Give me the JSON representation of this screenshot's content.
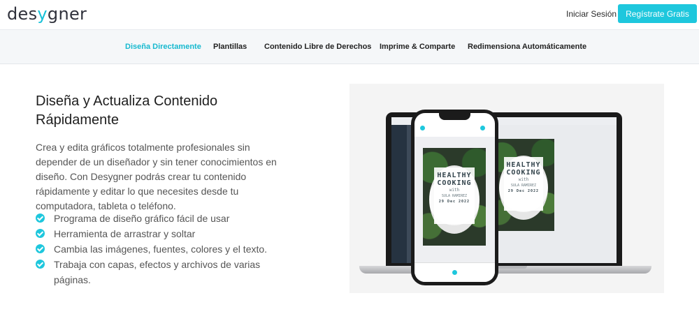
{
  "header": {
    "logo": {
      "part1": "des",
      "part2": "y",
      "part3": "gner"
    },
    "login_label": "Iniciar Sesión",
    "register_label": "Regístrate Gratis"
  },
  "nav": {
    "items": [
      {
        "label": "Diseña Directamente",
        "active": true
      },
      {
        "label": "Plantillas",
        "active": false
      },
      {
        "label": "Contenido Libre de Derechos",
        "active": false
      },
      {
        "label": "Imprime & Comparte",
        "active": false
      },
      {
        "label": "Redimensiona Automáticamente",
        "active": false
      }
    ]
  },
  "main": {
    "headline": "Diseña y Actualiza Contenido Rápidamente",
    "description": "Crea y edita gráficos totalmente profesionales sin depender de un diseñador y sin tener conocimientos en diseño. Con Desygner podrás crear tu contenido rápidamente y editar lo que necesites desde tu computadora, tableta o teléfono.",
    "features": [
      "Programa de diseño gráfico fácil de usar",
      "Herramienta de arrastrar y soltar",
      "Cambia las imágenes, fuentes, colores y el texto.",
      "Trabaja con capas, efectos y archivos de varias páginas."
    ]
  },
  "mockup": {
    "poster_title_1": "HEALTHY",
    "poster_title_2": "COOKING",
    "poster_subtitle": "with",
    "poster_names": "SULA RAMIREZ",
    "poster_date": "29 Dec 2022"
  },
  "colors": {
    "accent": "#1ec7dd",
    "active_nav": "#17b9cf"
  }
}
